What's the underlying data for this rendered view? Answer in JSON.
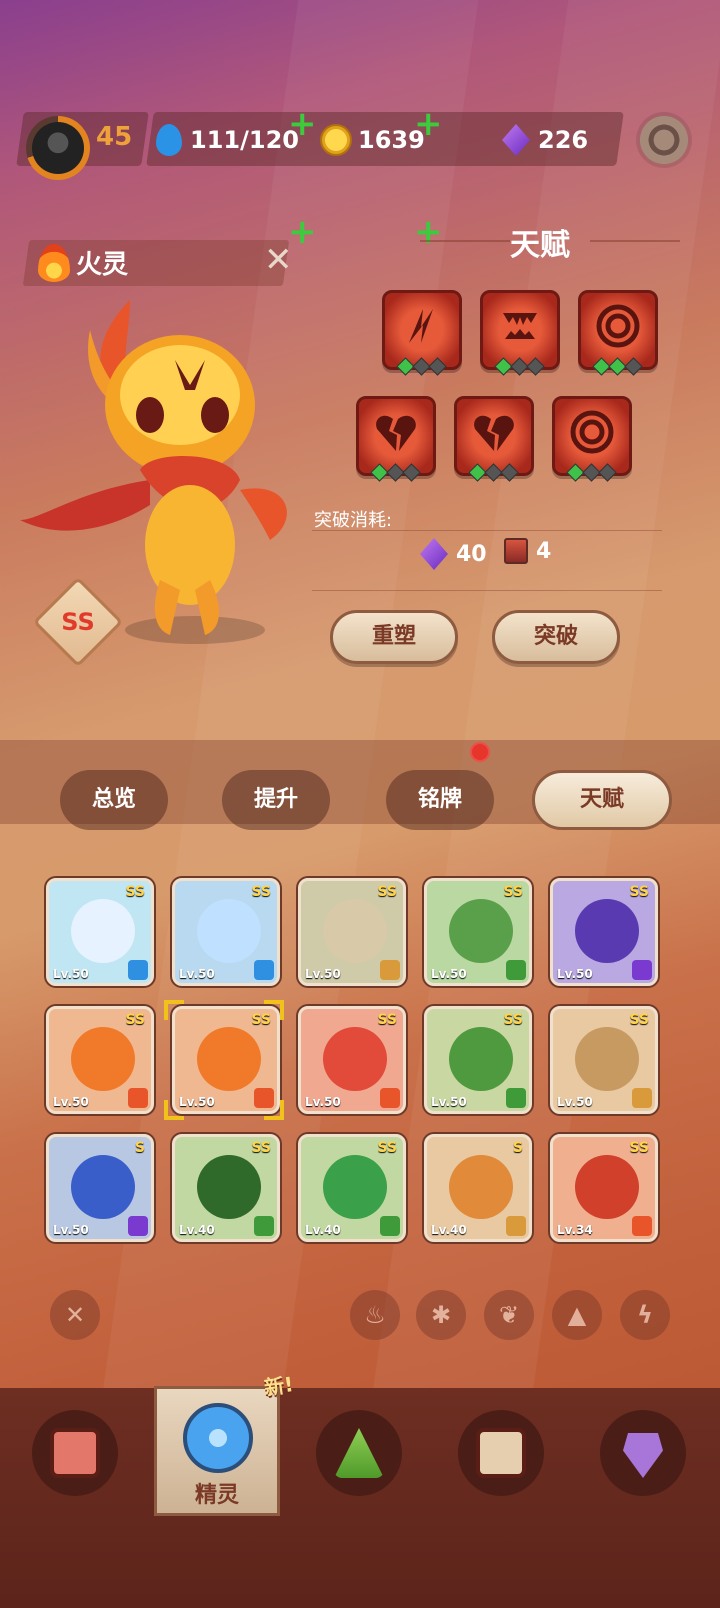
{
  "topbar": {
    "level": "45",
    "stamina": "111/120",
    "coins": "1639",
    "gems": "226"
  },
  "pet": {
    "name": "火灵",
    "rank": "SS"
  },
  "talent": {
    "title": "天赋",
    "cost_label": "突破消耗:",
    "cost_gems": "40",
    "cost_tickets": "4",
    "reset_label": "重塑",
    "breakthrough_label": "突破"
  },
  "tabs": [
    "总览",
    "提升",
    "铭牌",
    "天赋"
  ],
  "pets": [
    {
      "rank": "SS",
      "lv": "Lv.50",
      "element": "ice"
    },
    {
      "rank": "SS",
      "lv": "Lv.50",
      "element": "ice"
    },
    {
      "rank": "SS",
      "lv": "Lv.50",
      "element": "earth"
    },
    {
      "rank": "SS",
      "lv": "Lv.50",
      "element": "leaf"
    },
    {
      "rank": "SS",
      "lv": "Lv.50",
      "element": "thunder"
    },
    {
      "rank": "SS",
      "lv": "Lv.50",
      "element": "fire"
    },
    {
      "rank": "SS",
      "lv": "Lv.50",
      "element": "fire"
    },
    {
      "rank": "SS",
      "lv": "Lv.50",
      "element": "fire"
    },
    {
      "rank": "SS",
      "lv": "Lv.50",
      "element": "leaf"
    },
    {
      "rank": "SS",
      "lv": "Lv.50",
      "element": "earth"
    },
    {
      "rank": "S",
      "lv": "Lv.50",
      "element": "thunder"
    },
    {
      "rank": "SS",
      "lv": "Lv.40",
      "element": "leaf"
    },
    {
      "rank": "SS",
      "lv": "Lv.40",
      "element": "leaf"
    },
    {
      "rank": "S",
      "lv": "Lv.40",
      "element": "earth"
    },
    {
      "rank": "SS",
      "lv": "Lv.34",
      "element": "fire"
    }
  ],
  "bottom_nav": {
    "active_label": "精灵",
    "new_badge": "新!"
  },
  "colors": {
    "fire": "#e8552a",
    "ice": "#2f8fe0",
    "earth": "#d89a3a",
    "leaf": "#3f9a3a",
    "thunder": "#7a3ad0",
    "accent_gold": "#f2c21c"
  }
}
